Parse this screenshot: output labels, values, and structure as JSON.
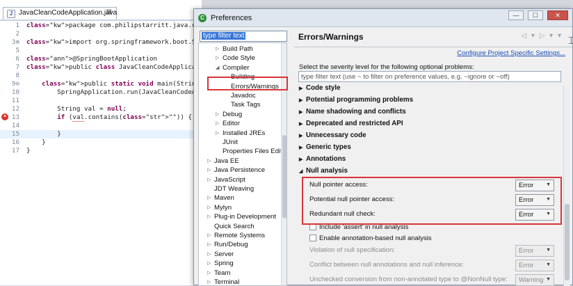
{
  "editor": {
    "tab_title": "JavaCleanCodeApplication.java",
    "tab_close": "⊠",
    "lines": [
      {
        "num": "1",
        "text": "package com.philipstarritt.java.clean.code;"
      },
      {
        "num": "2",
        "text": ""
      },
      {
        "num": "3⊕",
        "text": "import org.springframework.boot.SpringApplicat"
      },
      {
        "num": "5",
        "text": ""
      },
      {
        "num": "6",
        "text": "@SpringBootApplication"
      },
      {
        "num": "7",
        "text": "public class JavaCleanCodeApplication {"
      },
      {
        "num": "8",
        "text": ""
      },
      {
        "num": "9⊖",
        "text": "    public static void main(String[] args) {"
      },
      {
        "num": "10",
        "text": "        SpringApplication.run(JavaCleanCodeApp"
      },
      {
        "num": "11",
        "text": ""
      },
      {
        "num": "12",
        "text": "        String val = null;"
      },
      {
        "num": "13",
        "text": "        if (val.contains(\"\")) {"
      },
      {
        "num": "14",
        "text": ""
      },
      {
        "num": "15",
        "text": "        }"
      },
      {
        "num": "16",
        "text": "    }"
      },
      {
        "num": "17",
        "text": "}"
      }
    ]
  },
  "dialog": {
    "title": "Preferences",
    "filter_text": "type filter text",
    "page_title": "Errors/Warnings",
    "config_link": "Configure Project Specific Settings...",
    "severity_label": "Select the severity level for the following optional problems:",
    "pref_filter_placeholder": "type filter text (use ~ to filter on preference values, e.g. ~ignore or ~off)"
  },
  "tree": {
    "items": [
      {
        "label": "Build Path",
        "arrow": "▷"
      },
      {
        "label": "Code Style",
        "arrow": "▷"
      },
      {
        "label": "Compiler",
        "arrow": "◢"
      },
      {
        "label": "Building",
        "arrow": ""
      },
      {
        "label": "Errors/Warnings",
        "arrow": ""
      },
      {
        "label": "Javadoc",
        "arrow": ""
      },
      {
        "label": "Task Tags",
        "arrow": ""
      },
      {
        "label": "Debug",
        "arrow": "▷"
      },
      {
        "label": "Editor",
        "arrow": "▷"
      },
      {
        "label": "Installed JREs",
        "arrow": "▷"
      },
      {
        "label": "JUnit",
        "arrow": ""
      },
      {
        "label": "Properties Files Edito",
        "arrow": ""
      },
      {
        "label": "Java EE",
        "arrow": "▷"
      },
      {
        "label": "Java Persistence",
        "arrow": "▷"
      },
      {
        "label": "JavaScript",
        "arrow": "▷"
      },
      {
        "label": "JDT Weaving",
        "arrow": ""
      },
      {
        "label": "Maven",
        "arrow": "▷"
      },
      {
        "label": "Mylyn",
        "arrow": "▷"
      },
      {
        "label": "Plug-in Development",
        "arrow": "▷"
      },
      {
        "label": "Quick Search",
        "arrow": ""
      },
      {
        "label": "Remote Systems",
        "arrow": "▷"
      },
      {
        "label": "Run/Debug",
        "arrow": "▷"
      },
      {
        "label": "Server",
        "arrow": "▷"
      },
      {
        "label": "Spring",
        "arrow": "▷"
      },
      {
        "label": "Team",
        "arrow": "▷"
      },
      {
        "label": "Terminal",
        "arrow": "▷"
      }
    ]
  },
  "sections": [
    {
      "label": "Code style",
      "tri": "▶"
    },
    {
      "label": "Potential programming problems",
      "tri": "▶"
    },
    {
      "label": "Name shadowing and conflicts",
      "tri": "▶"
    },
    {
      "label": "Deprecated and restricted API",
      "tri": "▶"
    },
    {
      "label": "Unnecessary code",
      "tri": "▶"
    },
    {
      "label": "Generic types",
      "tri": "▶"
    },
    {
      "label": "Annotations",
      "tri": "▶"
    },
    {
      "label": "Null analysis",
      "tri": "◢"
    }
  ],
  "null_options": [
    {
      "label": "Null pointer access:",
      "value": "Error"
    },
    {
      "label": "Potential null pointer access:",
      "value": "Error"
    },
    {
      "label": "Redundant null check:",
      "value": "Error"
    }
  ],
  "checkboxes": [
    {
      "label": "Include 'assert' in null analysis"
    },
    {
      "label": "Enable annotation-based null analysis"
    }
  ],
  "disabled_options": [
    {
      "label": "Violation of null specification:",
      "value": "Error"
    },
    {
      "label": "Conflict between null annotations and null inference:",
      "value": "Error"
    },
    {
      "label": "Unchecked conversion from non-annotated type to @NonNull type:",
      "value": "Warning"
    }
  ],
  "colors": {
    "highlight": "#d8343a",
    "link": "#1a4fb8",
    "selection": "#3776d6"
  }
}
